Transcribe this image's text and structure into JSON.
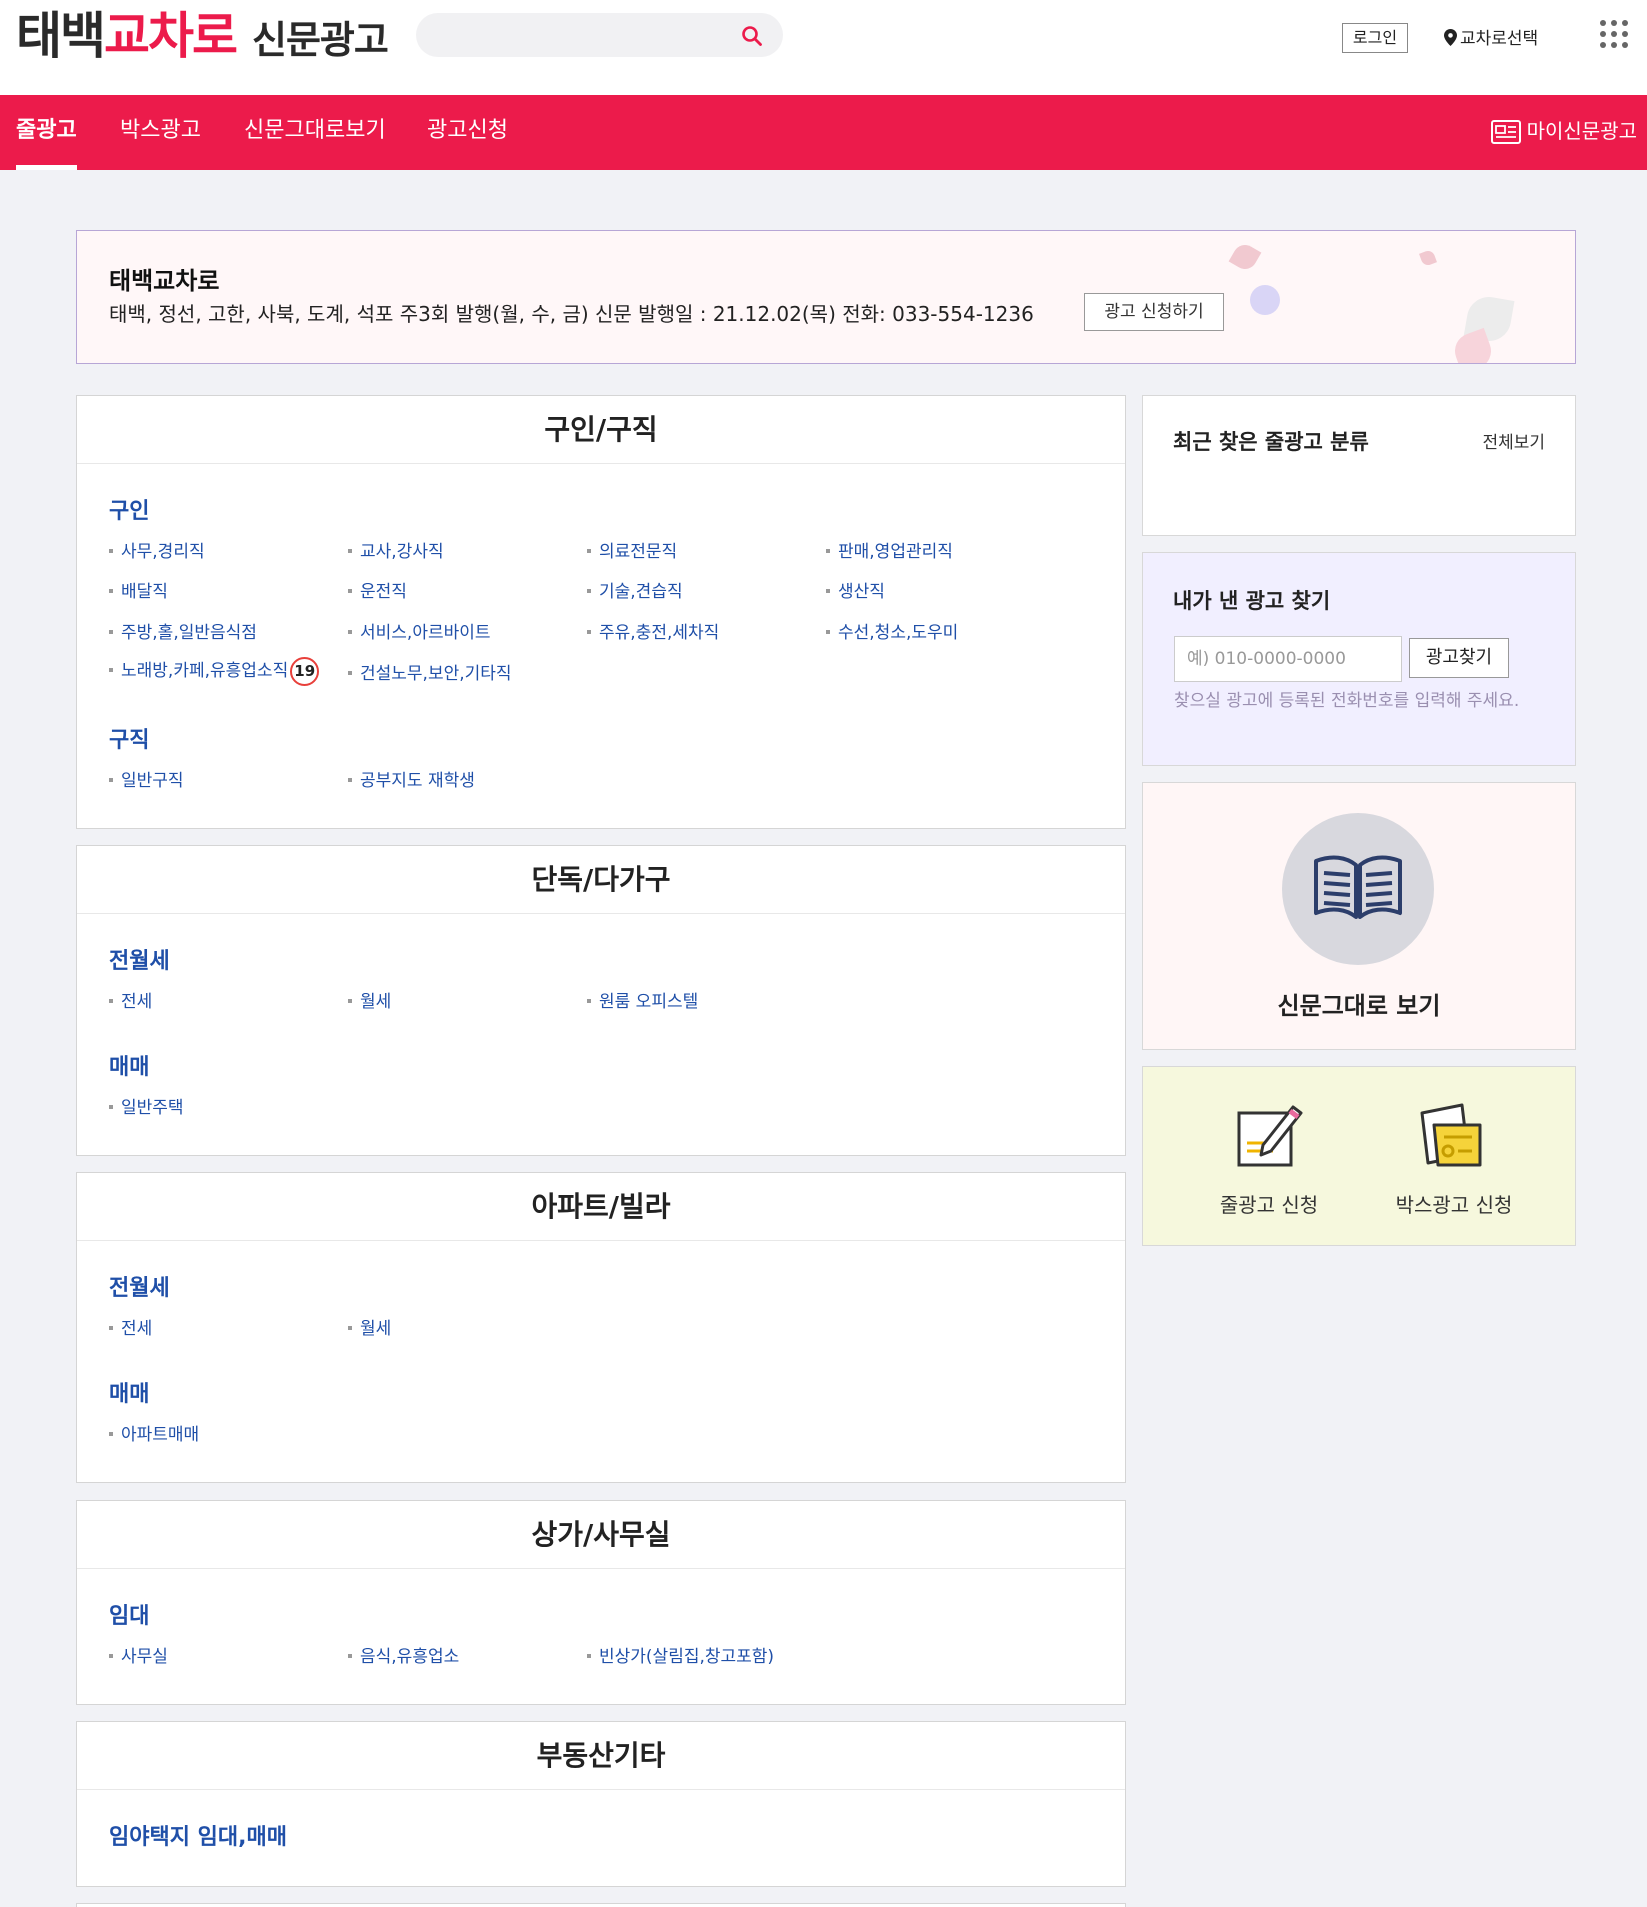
{
  "header": {
    "logo": {
      "part1": "태백",
      "part2": "교차로",
      "part3": "신문광고"
    },
    "search_placeholder": "",
    "login": "로그인",
    "location": "교차로선택"
  },
  "nav": {
    "items": [
      "줄광고",
      "박스광고",
      "신문그대로보기",
      "광고신청"
    ],
    "active": "줄광고",
    "my_news": "마이신문광고"
  },
  "banner": {
    "title": "태백교차로",
    "desc": "태백, 정선, 고한, 사북, 도계, 석포 주3회 발행(월, 수, 금) 신문 발행일 : 21.12.02(목) 전화: 033-554-1236",
    "button": "광고 신청하기"
  },
  "sections": [
    {
      "title": "구인/구직",
      "groups": [
        {
          "name": "구인",
          "links": [
            "사무,경리직",
            "교사,강사직",
            "의료전문직",
            "판매,영업관리직",
            "배달직",
            "운전직",
            "기술,견습직",
            "생산직",
            "주방,홀,일반음식점",
            "서비스,아르바이트",
            "주유,충전,세차직",
            "수선,청소,도우미",
            "노래방,카페,유흥업소직",
            "건설노무,보안,기타직"
          ]
        },
        {
          "name": "구직",
          "links": [
            "일반구직",
            "공부지도 재학생"
          ]
        }
      ],
      "adult_badge": "19"
    },
    {
      "title": "단독/다가구",
      "groups": [
        {
          "name": "전월세",
          "links": [
            "전세",
            "월세",
            "원룸 오피스텔"
          ]
        },
        {
          "name": "매매",
          "links": [
            "일반주택"
          ]
        }
      ]
    },
    {
      "title": "아파트/빌라",
      "groups": [
        {
          "name": "전월세",
          "links": [
            "전세",
            "월세"
          ]
        },
        {
          "name": "매매",
          "links": [
            "아파트매매"
          ]
        }
      ]
    },
    {
      "title": "상가/사무실",
      "groups": [
        {
          "name": "임대",
          "links": [
            "사무실",
            "음식,유흥업소",
            "빈상가(살림집,창고포함)"
          ]
        }
      ]
    },
    {
      "title": "부동산기타",
      "groups": [
        {
          "name": "임야택지 임대,매매",
          "links": []
        }
      ]
    }
  ],
  "sidebar": {
    "recent": {
      "title": "최근 찾은 줄광고 분류",
      "all": "전체보기"
    },
    "find": {
      "title": "내가 낸 광고 찾기",
      "placeholder": "예) 010-0000-0000",
      "button": "광고찾기",
      "help": "찾으실 광고에 등록된 전화번호를 입력해 주세요."
    },
    "paper": {
      "title": "신문그대로 보기"
    },
    "apply": {
      "line_ad": "줄광고 신청",
      "box_ad": "박스광고 신청"
    }
  },
  "colors": {
    "brand": "#ec1b4b",
    "link": "#1f4fa8",
    "badge_ring": "#e8403b"
  },
  "icons": [
    "search-icon",
    "location-pin-icon",
    "apps-grid-icon",
    "newspaper-icon",
    "open-book-icon",
    "pen-paper-icon",
    "box-paper-icon"
  ]
}
